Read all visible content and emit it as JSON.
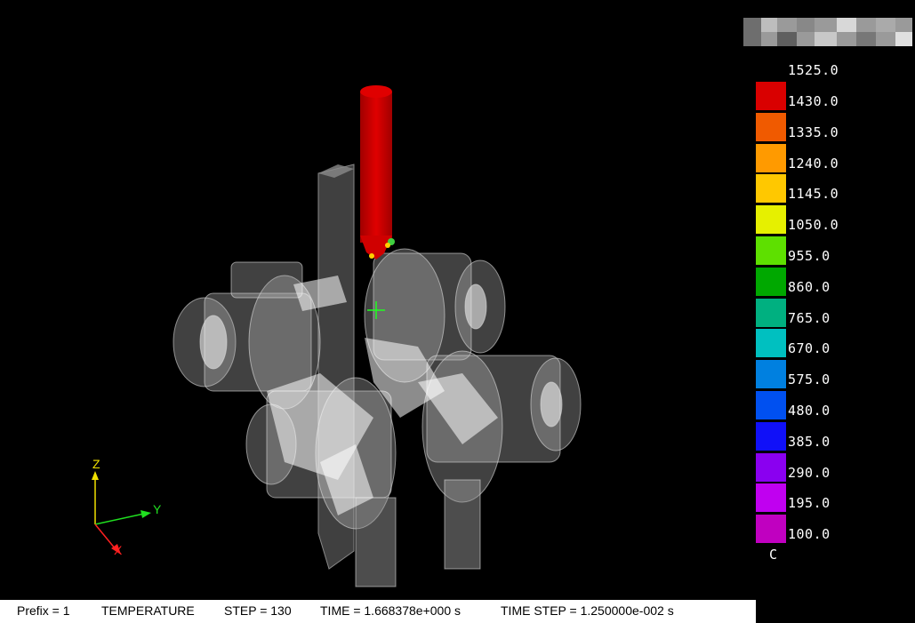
{
  "status_bar": {
    "prefix": "Prefix = 1",
    "field": "TEMPERATURE",
    "step": "STEP = 130",
    "time": "TIME = 1.668378e+000 s",
    "time_step": "TIME STEP = 1.250000e-002 s"
  },
  "legend": {
    "max_label": "1525.0",
    "unit": "C",
    "entries": [
      {
        "label": "1430.0",
        "color": "#d90000"
      },
      {
        "label": "1335.0",
        "color": "#f05a00"
      },
      {
        "label": "1240.0",
        "color": "#ff9a00"
      },
      {
        "label": "1145.0",
        "color": "#ffc800"
      },
      {
        "label": "1050.0",
        "color": "#e6f000"
      },
      {
        "label": "955.0",
        "color": "#5ee000"
      },
      {
        "label": "860.0",
        "color": "#00a800"
      },
      {
        "label": "765.0",
        "color": "#00b080"
      },
      {
        "label": "670.0",
        "color": "#00c0c0"
      },
      {
        "label": "575.0",
        "color": "#0080e0"
      },
      {
        "label": "480.0",
        "color": "#0050f0"
      },
      {
        "label": "385.0",
        "color": "#1010f8"
      },
      {
        "label": "290.0",
        "color": "#8a00f0"
      },
      {
        "label": "195.0",
        "color": "#c000f0"
      },
      {
        "label": "100.0",
        "color": "#c000c0"
      }
    ]
  },
  "triad": {
    "x_label": "X",
    "y_label": "Y",
    "z_label": "Z",
    "x_color": "#ff2020",
    "y_color": "#20e020",
    "z_color": "#f0e000"
  },
  "icons": [
    "axis-triad-icon",
    "crosshair-icon"
  ]
}
